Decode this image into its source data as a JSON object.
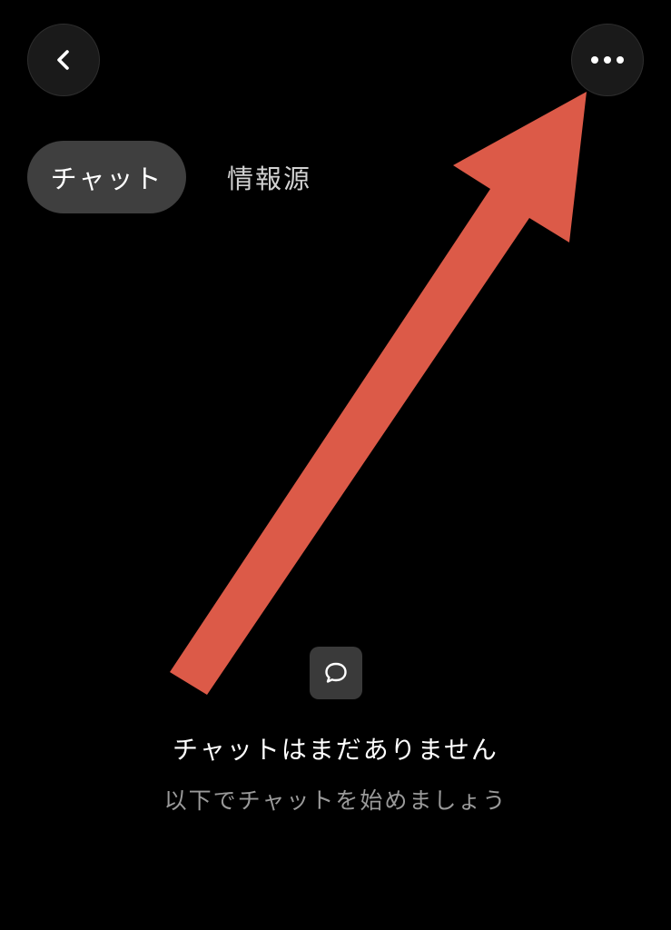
{
  "header": {
    "back_icon": "chevron-left-icon",
    "more_icon": "more-horizontal-icon"
  },
  "tabs": [
    {
      "label": "チャット",
      "active": true
    },
    {
      "label": "情報源",
      "active": false
    }
  ],
  "empty_state": {
    "icon": "chat-bubble-icon",
    "title": "チャットはまだありません",
    "subtitle": "以下でチャットを始めましょう"
  },
  "annotation": {
    "icon": "arrow-icon",
    "color": "#dc5a48"
  }
}
